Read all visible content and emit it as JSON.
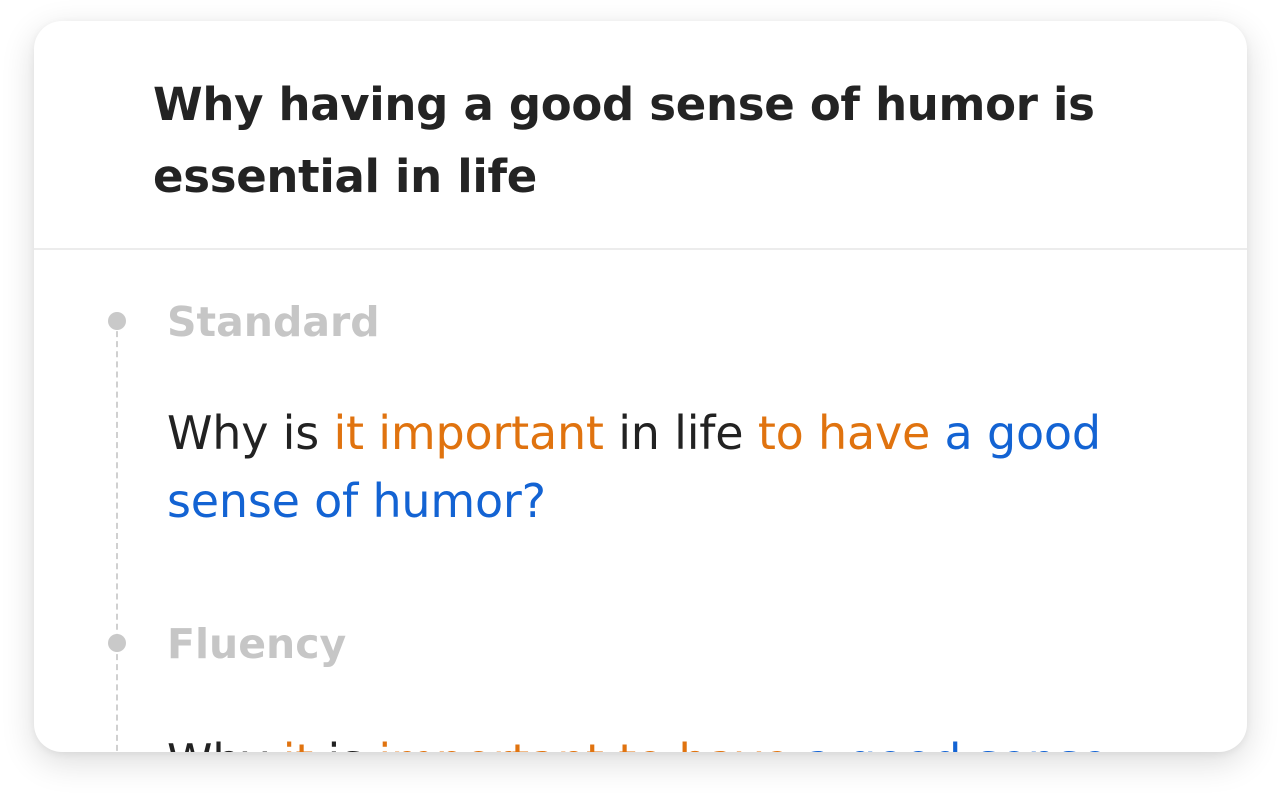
{
  "card": {
    "title": "Why having a good sense of humor is essential in life"
  },
  "sections": [
    {
      "label": "Standard",
      "segments": [
        {
          "text": "Why is ",
          "tone": "plain"
        },
        {
          "text": "it important",
          "tone": "orange"
        },
        {
          "text": " in life ",
          "tone": "plain"
        },
        {
          "text": "to have",
          "tone": "orange"
        },
        {
          "text": " a good sense of humor?",
          "tone": "blue"
        }
      ]
    },
    {
      "label": "Fluency",
      "segments": [
        {
          "text": "Why ",
          "tone": "plain"
        },
        {
          "text": "it",
          "tone": "orange"
        },
        {
          "text": " is ",
          "tone": "plain"
        },
        {
          "text": "important to have",
          "tone": "orange"
        },
        {
          "text": " a good sense",
          "tone": "blue"
        }
      ]
    }
  ],
  "colors": {
    "title": "#232323",
    "label": "#c6c6c6",
    "plain": "#222222",
    "orange": "#e0730f",
    "blue": "#1363d3",
    "divider": "#ececec",
    "timeline": "#d0d0d0"
  }
}
